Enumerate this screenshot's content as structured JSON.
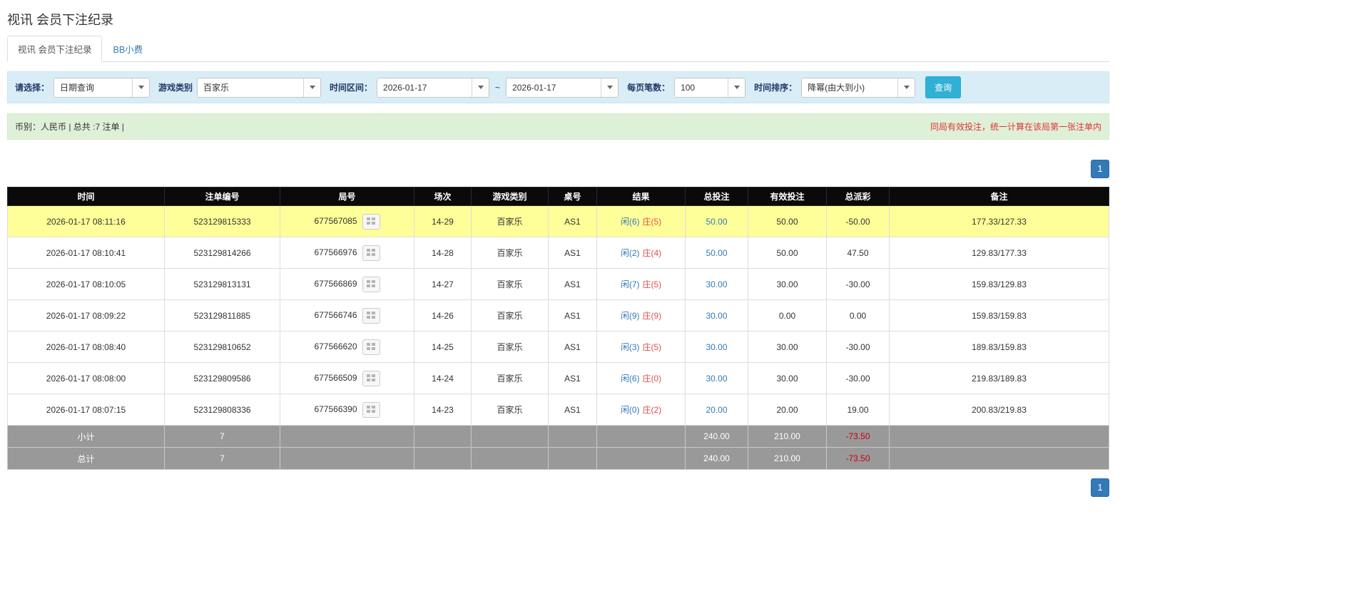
{
  "page": {
    "title": "视讯 会员下注纪录"
  },
  "tabs": [
    {
      "label": "视讯 会员下注纪录"
    },
    {
      "label": "BB小费"
    }
  ],
  "filters": {
    "select_label": "请选择：",
    "select_value": "日期查询",
    "game_type_label": "游戏类别",
    "game_type_value": "百家乐",
    "date_range_label": "时间区间：",
    "date_from": "2026-01-17",
    "range_separator": "~",
    "date_to": "2026-01-17",
    "page_size_label": "每页笔数：",
    "page_size_value": "100",
    "sort_label": "时间排序：",
    "sort_value": "降幂(由大到小)",
    "search_button": "查询"
  },
  "summary_bar": {
    "left": "币别：人民币 | 总共 :7 注单 |",
    "right": "同局有效投注，统一计算在该局第一张注单内"
  },
  "pagination": {
    "page": "1"
  },
  "table": {
    "headers": [
      "时间",
      "注单编号",
      "局号",
      "场次",
      "游戏类别",
      "桌号",
      "结果",
      "总投注",
      "有效投注",
      "总派彩",
      "备注"
    ],
    "rows": [
      {
        "time": "2026-01-17 08:11:16",
        "bet_id": "523129815333",
        "round": "677567085",
        "session": "14-29",
        "game": "百家乐",
        "table_no": "AS1",
        "result_player": "闲(6)",
        "result_banker": "庄(5)",
        "total_bet": "50.00",
        "valid_bet": "50.00",
        "payout": "-50.00",
        "note": "177.33/127.33",
        "highlight": true
      },
      {
        "time": "2026-01-17 08:10:41",
        "bet_id": "523129814266",
        "round": "677566976",
        "session": "14-28",
        "game": "百家乐",
        "table_no": "AS1",
        "result_player": "闲(2)",
        "result_banker": "庄(4)",
        "total_bet": "50.00",
        "valid_bet": "50.00",
        "payout": "47.50",
        "note": "129.83/177.33",
        "highlight": false
      },
      {
        "time": "2026-01-17 08:10:05",
        "bet_id": "523129813131",
        "round": "677566869",
        "session": "14-27",
        "game": "百家乐",
        "table_no": "AS1",
        "result_player": "闲(7)",
        "result_banker": "庄(5)",
        "total_bet": "30.00",
        "valid_bet": "30.00",
        "payout": "-30.00",
        "note": "159.83/129.83",
        "highlight": false
      },
      {
        "time": "2026-01-17 08:09:22",
        "bet_id": "523129811885",
        "round": "677566746",
        "session": "14-26",
        "game": "百家乐",
        "table_no": "AS1",
        "result_player": "闲(9)",
        "result_banker": "庄(9)",
        "total_bet": "30.00",
        "valid_bet": "0.00",
        "payout": "0.00",
        "note": "159.83/159.83",
        "highlight": false
      },
      {
        "time": "2026-01-17 08:08:40",
        "bet_id": "523129810652",
        "round": "677566620",
        "session": "14-25",
        "game": "百家乐",
        "table_no": "AS1",
        "result_player": "闲(3)",
        "result_banker": "庄(5)",
        "total_bet": "30.00",
        "valid_bet": "30.00",
        "payout": "-30.00",
        "note": "189.83/159.83",
        "highlight": false
      },
      {
        "time": "2026-01-17 08:08:00",
        "bet_id": "523129809586",
        "round": "677566509",
        "session": "14-24",
        "game": "百家乐",
        "table_no": "AS1",
        "result_player": "闲(6)",
        "result_banker": "庄(0)",
        "total_bet": "30.00",
        "valid_bet": "30.00",
        "payout": "-30.00",
        "note": "219.83/189.83",
        "highlight": false
      },
      {
        "time": "2026-01-17 08:07:15",
        "bet_id": "523129808336",
        "round": "677566390",
        "session": "14-23",
        "game": "百家乐",
        "table_no": "AS1",
        "result_player": "闲(0)",
        "result_banker": "庄(2)",
        "total_bet": "20.00",
        "valid_bet": "20.00",
        "payout": "19.00",
        "note": "200.83/219.83",
        "highlight": false
      }
    ],
    "subtotal": {
      "label": "小计",
      "count": "7",
      "total_bet": "240.00",
      "valid_bet": "210.00",
      "payout": "-73.50"
    },
    "total": {
      "label": "总计",
      "count": "7",
      "total_bet": "240.00",
      "valid_bet": "210.00",
      "payout": "-73.50"
    }
  },
  "colors": {
    "accent_blue": "#337ab7",
    "banker_red": "#d9534f",
    "negative_red": "#e60000",
    "highlight_yellow": "#ffff99",
    "header_black": "#0a0a0a",
    "summary_gray": "#999999"
  }
}
